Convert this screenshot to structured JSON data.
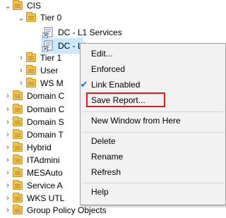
{
  "tree": {
    "items": [
      {
        "label": "CIS",
        "expanded": true,
        "type": "folder"
      },
      {
        "label": "Tier 0",
        "expanded": true,
        "type": "folder"
      },
      {
        "label": "DC - L1 Services",
        "type": "gpo"
      },
      {
        "label": "DC - L1",
        "type": "gpo",
        "selected": true
      },
      {
        "label": "Tier 1",
        "expanded": false,
        "type": "folder"
      },
      {
        "label": "User",
        "expanded": false,
        "type": "folder"
      },
      {
        "label": "WS M",
        "expanded": false,
        "type": "folder"
      },
      {
        "label": "Domain C",
        "expanded": false,
        "type": "folder"
      },
      {
        "label": "Domain C",
        "expanded": false,
        "type": "folder"
      },
      {
        "label": "Domain S",
        "expanded": false,
        "type": "folder"
      },
      {
        "label": "Domain T",
        "expanded": false,
        "type": "folder"
      },
      {
        "label": "Hybrid",
        "expanded": false,
        "type": "folder"
      },
      {
        "label": "ITAdmini",
        "expanded": false,
        "type": "folder"
      },
      {
        "label": "MESAuto",
        "expanded": false,
        "type": "folder"
      },
      {
        "label": "Service A",
        "expanded": false,
        "type": "folder"
      },
      {
        "label": "WKS UTL",
        "expanded": false,
        "type": "folder"
      },
      {
        "label": "Group Policy Objects",
        "expanded": false,
        "type": "folder"
      }
    ]
  },
  "context_menu": {
    "items": [
      {
        "label": "Edit...",
        "checked": false
      },
      {
        "label": "Enforced",
        "checked": false
      },
      {
        "label": "Link Enabled",
        "checked": true
      },
      {
        "label": "Save Report...",
        "checked": false,
        "highlighted": true
      },
      {
        "label": "New Window from Here",
        "checked": false
      },
      {
        "label": "Delete",
        "checked": false
      },
      {
        "label": "Rename",
        "checked": false
      },
      {
        "label": "Refresh",
        "checked": false
      },
      {
        "label": "Help",
        "checked": false
      }
    ]
  },
  "colors": {
    "folder": "#f2c24e",
    "selection": "#cce8ff",
    "highlight_border": "#e0191a",
    "check": "#1e6fd0"
  }
}
